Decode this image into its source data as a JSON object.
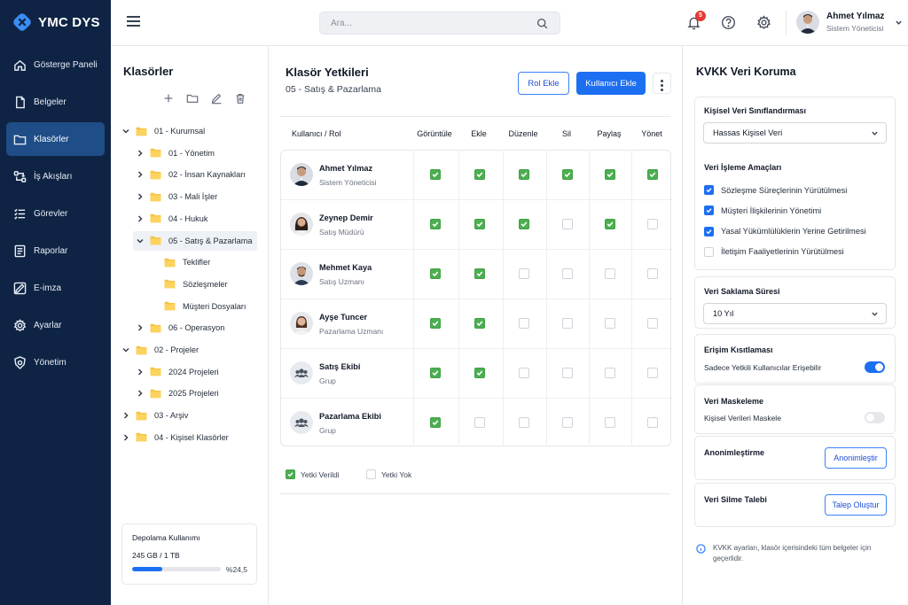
{
  "app": {
    "name": "YMC DYS"
  },
  "sidebar": {
    "items": [
      {
        "label": "Gösterge Paneli",
        "icon": "home-icon"
      },
      {
        "label": "Belgeler",
        "icon": "document-icon"
      },
      {
        "label": "Klasörler",
        "icon": "folder-icon",
        "active": true
      },
      {
        "label": "İş Akışları",
        "icon": "workflow-icon"
      },
      {
        "label": "Görevler",
        "icon": "tasks-icon"
      },
      {
        "label": "Raporlar",
        "icon": "report-icon"
      },
      {
        "label": "E-imza",
        "icon": "signature-icon"
      },
      {
        "label": "Ayarlar",
        "icon": "gear-icon"
      },
      {
        "label": "Yönetim",
        "icon": "admin-gear-icon"
      }
    ]
  },
  "topbar": {
    "search_placeholder": "Ara...",
    "notification_count": "5",
    "user": {
      "name": "Ahmet Yılmaz",
      "role": "Sistem Yöneticisi"
    }
  },
  "folders": {
    "title": "Klasörler",
    "tree": [
      {
        "label": "01 - Kurumsal",
        "level": 0,
        "expanded": true
      },
      {
        "label": "01 - Yönetim",
        "level": 1,
        "expanded": false
      },
      {
        "label": "02 - İnsan Kaynakları",
        "level": 1,
        "expanded": false
      },
      {
        "label": "03 - Mali İşler",
        "level": 1,
        "expanded": false
      },
      {
        "label": "04 - Hukuk",
        "level": 1,
        "expanded": false
      },
      {
        "label": "05 - Satış & Pazarlama",
        "level": 1,
        "expanded": true,
        "selected": true
      },
      {
        "label": "Teklifler",
        "level": 2,
        "leaf": true
      },
      {
        "label": "Sözleşmeler",
        "level": 2,
        "leaf": true
      },
      {
        "label": "Müşteri Dosyaları",
        "level": 2,
        "leaf": true
      },
      {
        "label": "06 - Operasyon",
        "level": 1,
        "expanded": false
      },
      {
        "label": "02 - Projeler",
        "level": 0,
        "expanded": true
      },
      {
        "label": "2024 Projeleri",
        "level": 1,
        "expanded": false
      },
      {
        "label": "2025 Projeleri",
        "level": 1,
        "expanded": false
      },
      {
        "label": "03 - Arşiv",
        "level": 0,
        "expanded": false
      },
      {
        "label": "04 - Kişisel Klasörler",
        "level": 0,
        "expanded": false
      }
    ],
    "storage": {
      "title": "Depolama Kullanımı",
      "value": "245 GB / 1 TB",
      "percent_label": "%24,5",
      "fraction": 0.245
    }
  },
  "permissions": {
    "title": "Klasör Yetkileri",
    "subtitle": "05 - Satış & Pazarlama",
    "add_role_label": "Rol Ekle",
    "add_user_label": "Kullanıcı Ekle",
    "columns": [
      "Kullanıcı / Rol",
      "Görüntüle",
      "Ekle",
      "Düzenle",
      "Sil",
      "Paylaş",
      "Yönet"
    ],
    "rows": [
      {
        "name": "Ahmet Yılmaz",
        "role": "Sistem Yöneticisi",
        "type": "user",
        "perms": [
          true,
          true,
          true,
          true,
          true,
          true
        ]
      },
      {
        "name": "Zeynep Demir",
        "role": "Satış Müdürü",
        "type": "user",
        "perms": [
          true,
          true,
          true,
          false,
          true,
          false
        ]
      },
      {
        "name": "Mehmet Kaya",
        "role": "Satış Uzmanı",
        "type": "user",
        "perms": [
          true,
          true,
          false,
          false,
          false,
          false
        ]
      },
      {
        "name": "Ayşe Tuncer",
        "role": "Pazarlama Uzmanı",
        "type": "user",
        "perms": [
          true,
          true,
          false,
          false,
          false,
          false
        ]
      },
      {
        "name": "Satış Ekibi",
        "role": "Grup",
        "type": "group",
        "perms": [
          true,
          true,
          false,
          false,
          false,
          false
        ]
      },
      {
        "name": "Pazarlama Ekibi",
        "role": "Grup",
        "type": "group",
        "perms": [
          true,
          false,
          false,
          false,
          false,
          false
        ]
      }
    ],
    "legend": {
      "granted": "Yetki Verildi",
      "none": "Yetki Yok"
    }
  },
  "kvkk": {
    "title": "KVKK Veri Koruma",
    "classification": {
      "label": "Kişisel Veri Sınıflandırması",
      "value": "Hassas Kişisel Veri"
    },
    "purposes": {
      "label": "Veri İşleme Amaçları",
      "options": [
        {
          "label": "Sözleşme Süreçlerinin Yürütülmesi",
          "checked": true
        },
        {
          "label": "Müşteri İlişkilerinin Yönetimi",
          "checked": true
        },
        {
          "label": "Yasal Yükümlülüklerin Yerine Getirilmesi",
          "checked": true
        },
        {
          "label": "İletişim Faaliyetlerinin Yürütülmesi",
          "checked": false
        }
      ]
    },
    "retention": {
      "label": "Veri Saklama Süresi",
      "value": "10 Yıl"
    },
    "access": {
      "label": "Erişim Kısıtlaması",
      "text": "Sadece Yetkili Kullanıcılar Erişebilir",
      "on": true
    },
    "masking": {
      "label": "Veri Maskeleme",
      "text": "Kişisel Verileri Maskele",
      "on": false
    },
    "anonymize": {
      "label": "Anonimleştirme",
      "button": "Anonimleştir"
    },
    "deletion": {
      "label": "Veri Silme Talebi",
      "button": "Talep Oluştur"
    },
    "note": "KVKK ayarları, klasör içerisindeki tüm belgeler için geçerlidir."
  }
}
